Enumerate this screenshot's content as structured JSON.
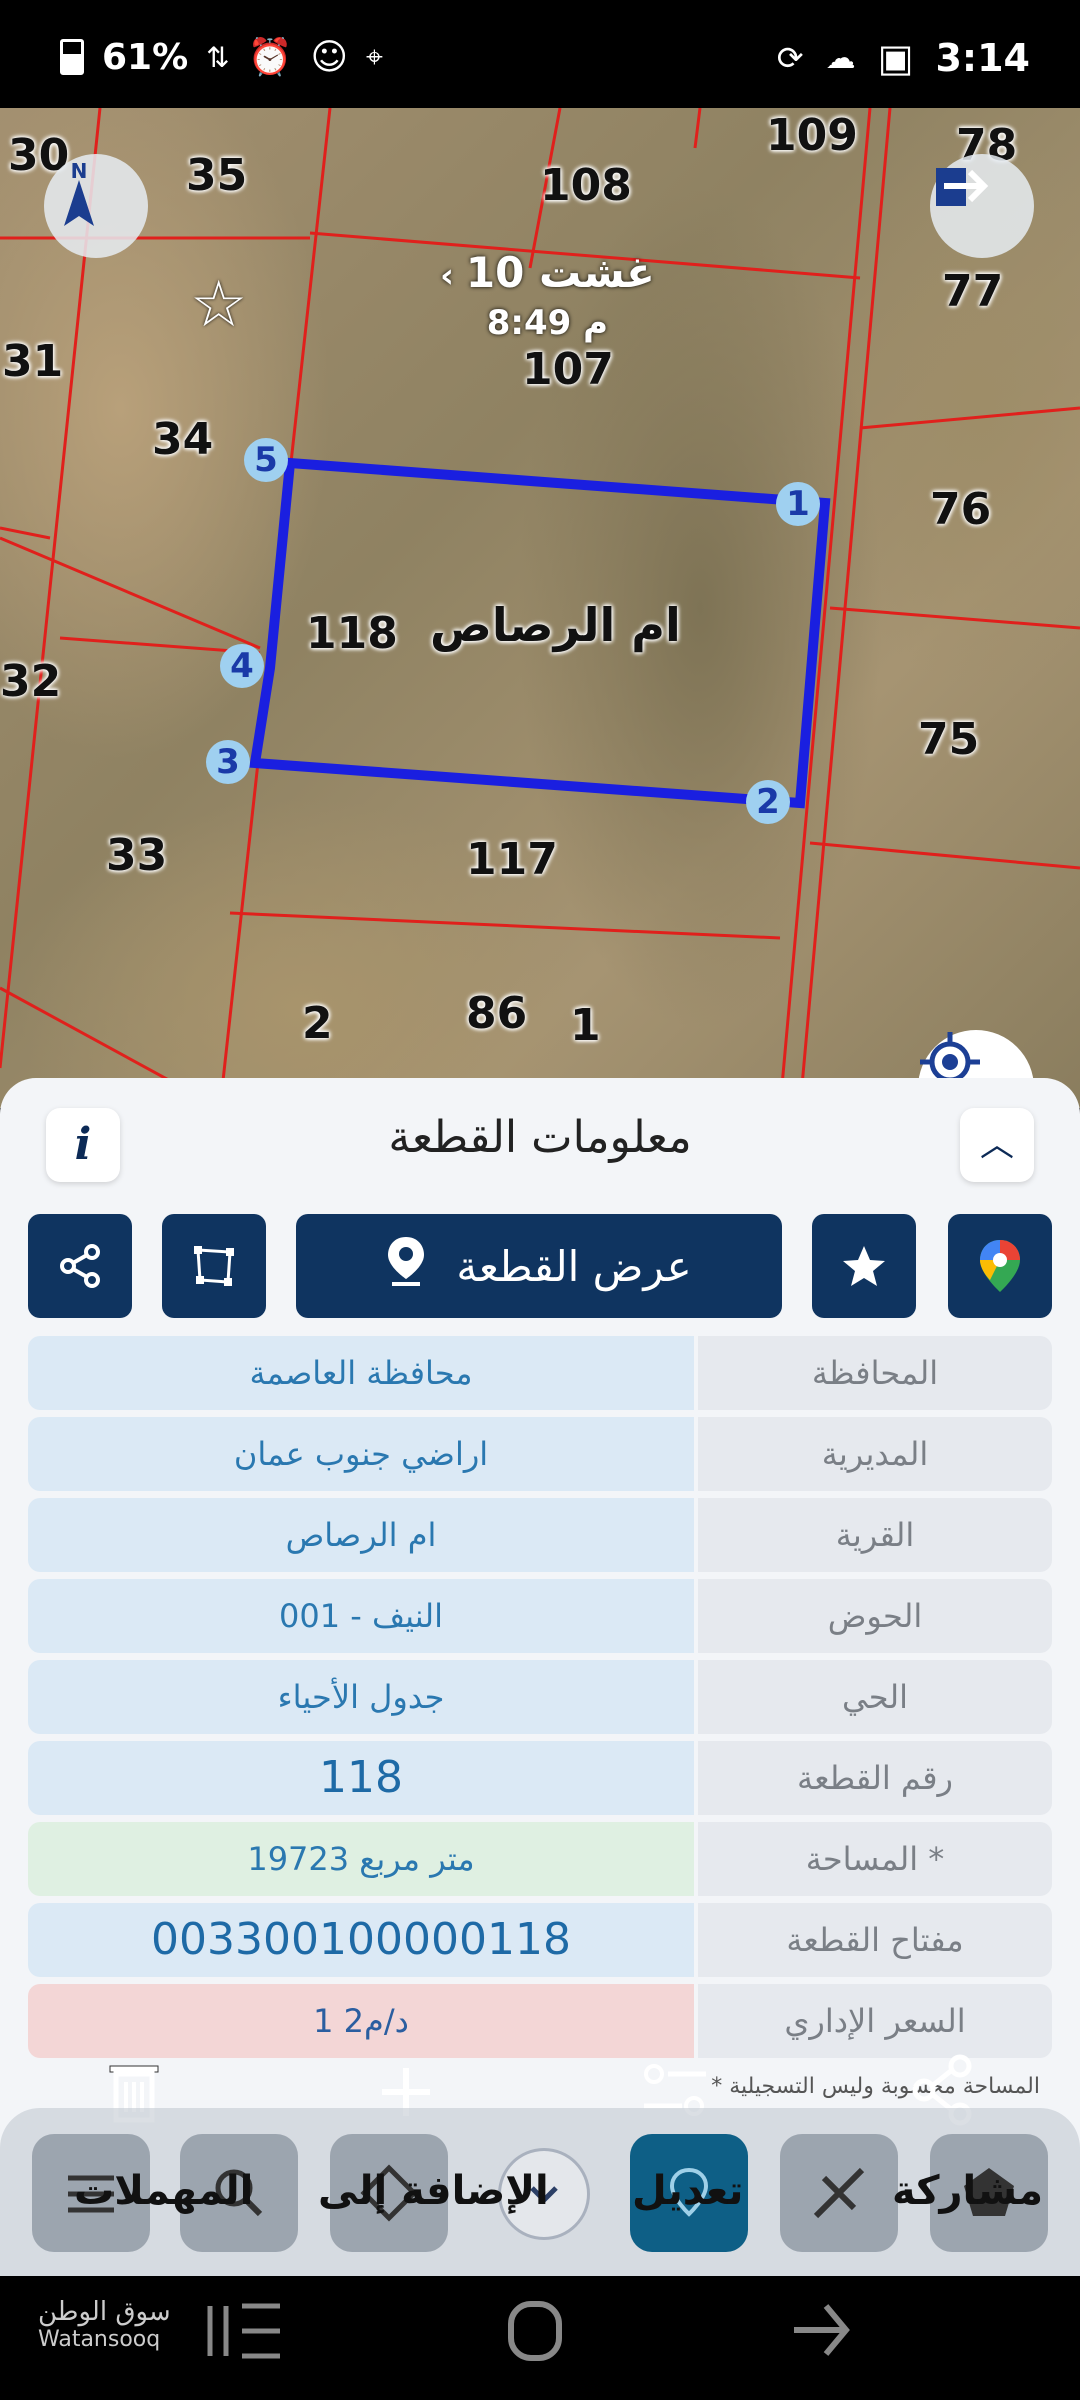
{
  "status_bar": {
    "battery": "61%",
    "time": "3:14"
  },
  "map": {
    "header": {
      "date": "10 غشت",
      "time": "8:49 م"
    },
    "village_label": "ام الرصاص",
    "plot_numbers": [
      "30",
      "35",
      "108",
      "109",
      "78",
      "77",
      "31",
      "107",
      "34",
      "76",
      "118",
      "32",
      "75",
      "33",
      "117",
      "2",
      "86",
      "1"
    ],
    "vertices": [
      "1",
      "2",
      "3",
      "4",
      "5"
    ]
  },
  "sheet": {
    "title": "معلومات القطعة",
    "show_plot_label": "عرض القطعة",
    "rows": [
      {
        "label": "المحافظة",
        "value": "محافظة العاصمة"
      },
      {
        "label": "المديرية",
        "value": "اراضي جنوب عمان"
      },
      {
        "label": "القرية",
        "value": "ام الرصاص"
      },
      {
        "label": "الحوض",
        "value": "النيف - 001"
      },
      {
        "label": "الحي",
        "value": "جدول الأحياء"
      },
      {
        "label": "رقم القطعة",
        "value": "118"
      },
      {
        "label": "المساحة *",
        "value": "19723  متر مربع"
      },
      {
        "label": "مفتاح القطعة",
        "value": "003300100000118"
      },
      {
        "label": "السعر الإداري",
        "value": "1 د/م2"
      }
    ],
    "note": "* المساحة محسوبة وليس التسجيلية"
  },
  "toolbar": {
    "tasks_label": "المهملات",
    "add_to_label": "الإضافة إلى",
    "edit_label": "تعديل",
    "share_label": "مشاركة"
  },
  "watermark": {
    "ar": "سوق الوطن",
    "en": "Watansooq"
  }
}
